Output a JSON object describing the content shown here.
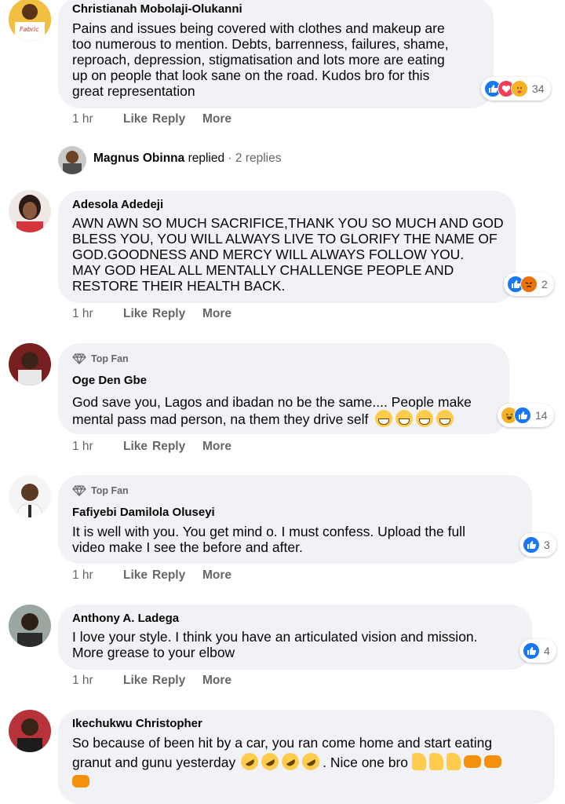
{
  "comments": [
    {
      "name": "Christianah Mobolaji-Olukanni",
      "lines": [
        "Pains and issues being covered with clothes and makeup are",
        "too numerous to mention. Debts, barrenness, failures, shame,",
        "reproach, depression, stigmatisation and lots more are eating",
        "up on people that look sane on the road. Kudos bro for this",
        "great representation"
      ],
      "time": "1 hr",
      "reactions": [
        "like",
        "love",
        "care"
      ],
      "reaction_count": "34"
    },
    {
      "name": "Adesola Adedeji",
      "lines": [
        "AWN AWN SO MUCH SACRIFICE,THANK YOU SO MUCH AND GOD",
        "BLESS YOU, YOU WILL ALWAYS LIVE TO GLORIFY THE NAME OF",
        "GOD.GOODNESS AND MERCY WILL ALWAYS FOLLOW YOU.",
        "MAY GOD HEAL ALL MENTALLY CHALLENGE PEOPLE AND",
        "RESTORE THEIR HEALTH BACK."
      ],
      "time": "1 hr",
      "reactions": [
        "like",
        "angry"
      ],
      "reaction_count": "2"
    },
    {
      "badge": "Top Fan",
      "name": "Oge Den Gbe",
      "lines": [
        "God save you, Lagos and ibadan no be the same.... People make",
        "mental pass mad person, na them they drive self"
      ],
      "time": "1 hr",
      "reactions": [
        "haha",
        "like"
      ],
      "reaction_count": "14"
    },
    {
      "badge": "Top Fan",
      "name": "Fafiyebi Damilola Oluseyi",
      "lines": [
        "It is well with you. You get mind o. I must confess. Upload the full",
        "video make I see the before and after."
      ],
      "time": "1 hr",
      "reactions": [
        "like"
      ],
      "reaction_count": "3"
    },
    {
      "name": "Anthony A. Ladega",
      "lines": [
        "I love your style. I think you have an articulated vision and mission.",
        "More grease to your elbow"
      ],
      "time": "1 hr",
      "reactions": [
        "like"
      ],
      "reaction_count": "4"
    },
    {
      "name": "Ikechukwu Christopher",
      "lines": [
        "So because of been hit by a car, you ran come home and start eating",
        "granut and gunu yesterday",
        ". Nice one bro"
      ]
    }
  ],
  "actions": {
    "like": "Like",
    "reply": "Reply",
    "more": "More"
  },
  "reply_summary": {
    "name": "Magnus Obinna",
    "verb": "replied",
    "sep": " · ",
    "count": "2 replies"
  },
  "colors": {
    "bubble": "#f0f2f5",
    "muted": "#65676b",
    "like_blue": "#1877f2"
  }
}
